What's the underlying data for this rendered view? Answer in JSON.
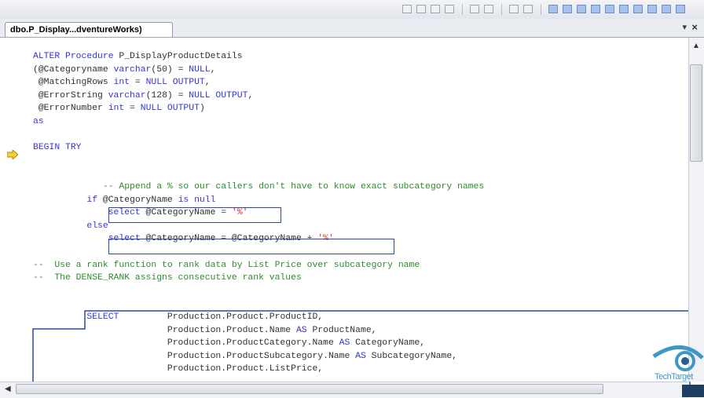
{
  "document_tab": {
    "title": "dbo.P_Display...dventureWorks)",
    "dropdown_glyph": "▾",
    "close_glyph": "×"
  },
  "editor": {
    "lines": [
      [
        {
          "c": "kw",
          "t": "ALTER Procedure "
        },
        {
          "c": "pl",
          "t": "P_DisplayProductDetails"
        }
      ],
      [
        {
          "c": "pl",
          "t": "(@Categoryname "
        },
        {
          "c": "kw",
          "t": "varchar"
        },
        {
          "c": "pl",
          "t": "(50) = "
        },
        {
          "c": "kw",
          "t": "NULL"
        },
        {
          "c": "pl",
          "t": ","
        }
      ],
      [
        {
          "c": "pl",
          "t": " @MatchingRows "
        },
        {
          "c": "kw",
          "t": "int"
        },
        {
          "c": "pl",
          "t": " = "
        },
        {
          "c": "kw",
          "t": "NULL OUTPUT"
        },
        {
          "c": "pl",
          "t": ","
        }
      ],
      [
        {
          "c": "pl",
          "t": " @ErrorString "
        },
        {
          "c": "kw",
          "t": "varchar"
        },
        {
          "c": "pl",
          "t": "(128) = "
        },
        {
          "c": "kw",
          "t": "NULL OUTPUT"
        },
        {
          "c": "pl",
          "t": ","
        }
      ],
      [
        {
          "c": "pl",
          "t": " @ErrorNumber "
        },
        {
          "c": "kw",
          "t": "int"
        },
        {
          "c": "pl",
          "t": " = "
        },
        {
          "c": "kw",
          "t": "NULL OUTPUT"
        },
        {
          "c": "pl",
          "t": ")"
        }
      ],
      [
        {
          "c": "kw",
          "t": "as"
        }
      ],
      [],
      [
        {
          "c": "kw",
          "t": "BEGIN TRY"
        }
      ],
      [],
      [],
      [
        {
          "c": "cm",
          "t": "             -- Append a % so our callers don't have to know exact subcategory names"
        }
      ],
      [
        {
          "c": "kw",
          "t": "          if "
        },
        {
          "c": "pl",
          "t": "@CategoryName "
        },
        {
          "c": "kw",
          "t": "is null"
        }
      ],
      [
        {
          "c": "kw",
          "t": "              select "
        },
        {
          "c": "pl",
          "t": "@CategoryName = "
        },
        {
          "c": "st",
          "t": "'%'"
        }
      ],
      [
        {
          "c": "kw",
          "t": "          else"
        }
      ],
      [
        {
          "c": "kw",
          "t": "              select "
        },
        {
          "c": "pl",
          "t": "@CategoryName = @CategoryName + "
        },
        {
          "c": "st",
          "t": "'%'"
        }
      ],
      [],
      [
        {
          "c": "cm",
          "t": "--  Use a rank function to rank data by List Price over subcategory name"
        }
      ],
      [
        {
          "c": "cm",
          "t": "--  The DENSE_RANK assigns consecutive rank values"
        }
      ],
      [],
      [],
      [
        {
          "c": "kw",
          "t": "          SELECT"
        },
        {
          "c": "pl",
          "t": "         Production.Product.ProductID,"
        }
      ],
      [
        {
          "c": "pl",
          "t": "                         Production.Product.Name "
        },
        {
          "c": "kw",
          "t": "AS"
        },
        {
          "c": "pl",
          "t": " ProductName,"
        }
      ],
      [
        {
          "c": "pl",
          "t": "                         Production.ProductCategory.Name "
        },
        {
          "c": "kw",
          "t": "AS"
        },
        {
          "c": "pl",
          "t": " CategoryName,"
        }
      ],
      [
        {
          "c": "pl",
          "t": "                         Production.ProductSubcategory.Name "
        },
        {
          "c": "kw",
          "t": "AS"
        },
        {
          "c": "pl",
          "t": " SubcategoryName,"
        }
      ],
      [
        {
          "c": "pl",
          "t": "                         Production.Product.ListPrice,"
        }
      ]
    ]
  },
  "watermark": {
    "text": "TechTarget"
  },
  "colors": {
    "keyword": "#3434d9",
    "comment": "#2e8b2e",
    "string": "#d0302a",
    "highlight_box": "#2e47a8"
  }
}
